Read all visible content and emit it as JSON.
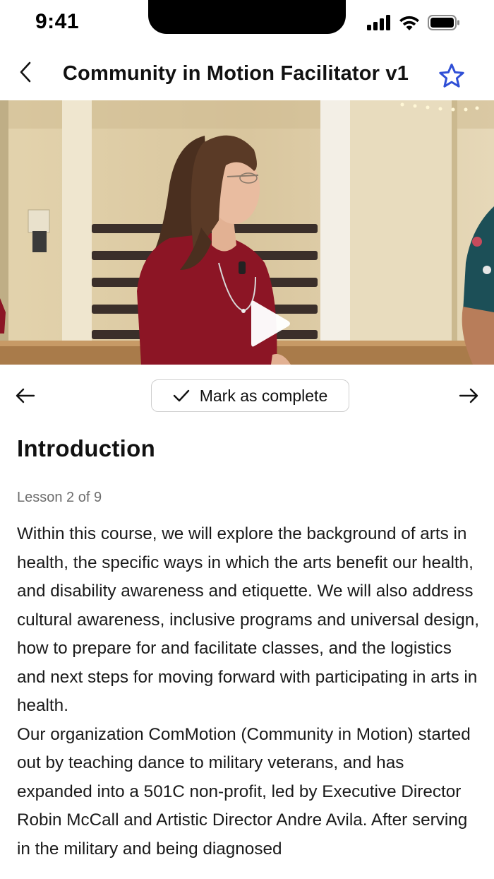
{
  "status_bar": {
    "time": "9:41"
  },
  "header": {
    "title": "Community in Motion Facilitator v1",
    "accent_color": "#2f4fd6"
  },
  "video": {
    "play_icon": "play-icon"
  },
  "nav": {
    "complete_label": "Mark as complete",
    "prev_icon": "arrow-left-icon",
    "next_icon": "arrow-right-icon"
  },
  "lesson": {
    "title": "Introduction",
    "progress": "Lesson 2 of 9",
    "paragraphs": [
      "Within this course, we will explore the background of arts in health, the specific ways in which the arts benefit our health, and disability awareness and etiquette. We will also address cultural awareness, inclusive programs and universal design, how to prepare for and facilitate classes, and the logistics and next steps for moving forward with participating in arts in health.",
      "Our organization ComMotion (Community in Motion) started out by teaching dance to military veterans, and has expanded into a 501C non-profit, led by Executive Director Robin McCall and Artistic Director Andre Avila. After serving in the military and being diagnosed"
    ]
  }
}
